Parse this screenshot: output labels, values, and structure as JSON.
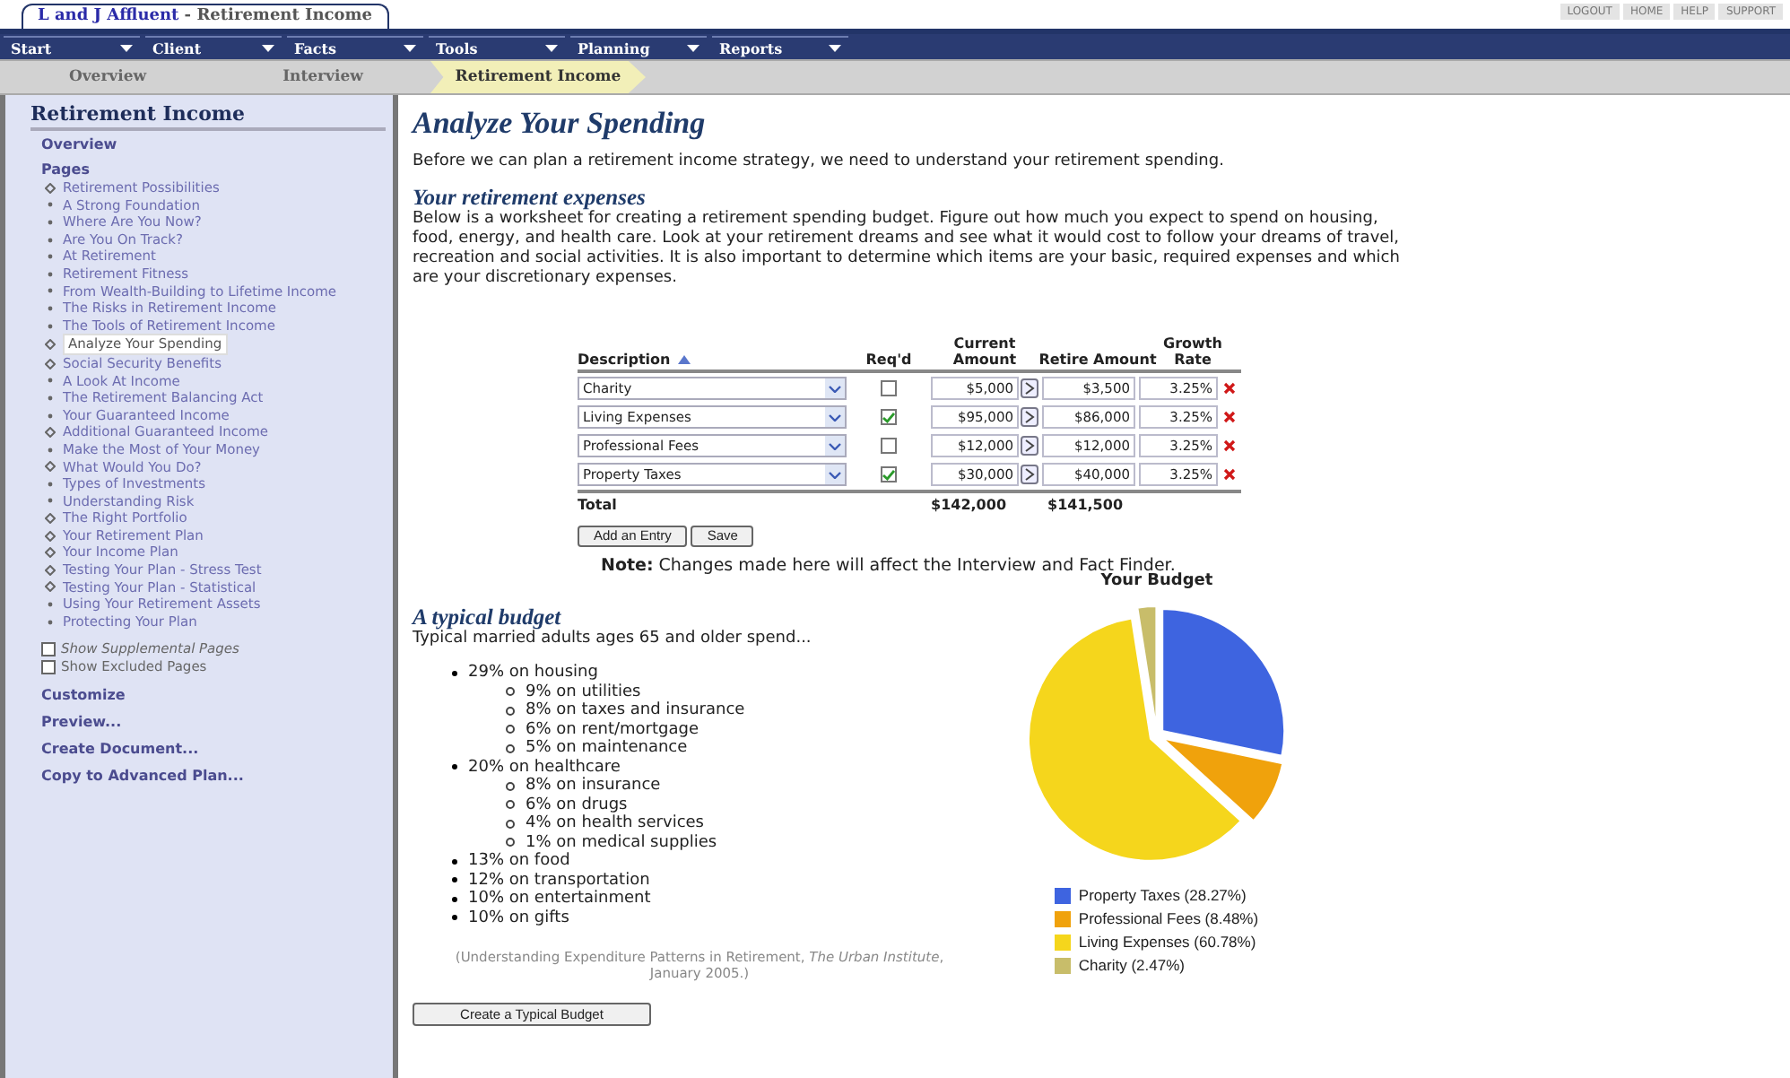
{
  "app_title": {
    "firm": "L and J Affluent",
    "separator": " - ",
    "page": "Retirement Income"
  },
  "top_links": [
    "LOGOUT",
    "HOME",
    "HELP",
    "SUPPORT"
  ],
  "menu": [
    "Start",
    "Client",
    "Facts",
    "Tools",
    "Planning",
    "Reports"
  ],
  "breadcrumb": [
    {
      "label": "Overview",
      "selected": false
    },
    {
      "label": "Interview",
      "selected": false
    },
    {
      "label": "Retirement Income",
      "selected": true
    }
  ],
  "sidebar": {
    "title": "Retirement Income",
    "overview": "Overview",
    "pages_label": "Pages",
    "pages": [
      {
        "label": "Retirement Possibilities",
        "kind": "diamond",
        "selected": false
      },
      {
        "label": "A Strong Foundation",
        "kind": "dot",
        "selected": false
      },
      {
        "label": "Where Are You Now?",
        "kind": "dot",
        "selected": false
      },
      {
        "label": "Are You On Track?",
        "kind": "dot",
        "selected": false
      },
      {
        "label": "At Retirement",
        "kind": "dot",
        "selected": false
      },
      {
        "label": "Retirement Fitness",
        "kind": "dot",
        "selected": false
      },
      {
        "label": "From Wealth-Building to Lifetime Income",
        "kind": "dot",
        "selected": false
      },
      {
        "label": "The Risks in Retirement Income",
        "kind": "dot",
        "selected": false
      },
      {
        "label": "The Tools of Retirement Income",
        "kind": "dot",
        "selected": false
      },
      {
        "label": "Analyze Your Spending",
        "kind": "diamond",
        "selected": true
      },
      {
        "label": "Social Security Benefits",
        "kind": "diamond",
        "selected": false
      },
      {
        "label": "A Look At Income",
        "kind": "dot",
        "selected": false
      },
      {
        "label": "The Retirement Balancing Act",
        "kind": "dot",
        "selected": false
      },
      {
        "label": "Your Guaranteed Income",
        "kind": "dot",
        "selected": false
      },
      {
        "label": "Additional Guaranteed Income",
        "kind": "diamond",
        "selected": false
      },
      {
        "label": "Make the Most of Your Money",
        "kind": "dot",
        "selected": false
      },
      {
        "label": "What Would You Do?",
        "kind": "diamond",
        "selected": false
      },
      {
        "label": "Types of Investments",
        "kind": "dot",
        "selected": false
      },
      {
        "label": "Understanding Risk",
        "kind": "dot",
        "selected": false
      },
      {
        "label": "The Right Portfolio",
        "kind": "diamond",
        "selected": false
      },
      {
        "label": "Your Retirement Plan",
        "kind": "diamond",
        "selected": false
      },
      {
        "label": "Your Income Plan",
        "kind": "diamond",
        "selected": false
      },
      {
        "label": "Testing Your Plan - Stress Test",
        "kind": "diamond",
        "selected": false
      },
      {
        "label": "Testing Your Plan - Statistical",
        "kind": "diamond",
        "selected": false
      },
      {
        "label": "Using Your Retirement Assets",
        "kind": "dot",
        "selected": false
      },
      {
        "label": "Protecting Your Plan",
        "kind": "dot",
        "selected": false
      }
    ],
    "options": [
      {
        "label": "Show Supplemental Pages",
        "checked": false,
        "italic": true
      },
      {
        "label": "Show Excluded Pages",
        "checked": false,
        "italic": false
      }
    ],
    "actions": [
      "Customize",
      "Preview...",
      "Create Document...",
      "Copy to Advanced Plan..."
    ]
  },
  "main": {
    "title": "Analyze Your Spending",
    "intro": "Before we can plan a retirement income strategy, we need to understand your retirement spending.",
    "expenses_heading": "Your retirement expenses",
    "expenses_text": "Below is a worksheet for creating a retirement spending budget. Figure out how much you expect to spend on housing, food, energy, and health care. Look at your retirement dreams and see what it would cost to follow your dreams of travel, recreation and social activities. It is also important to determine which items are your basic, required expenses and which are your discretionary expenses.",
    "table": {
      "columns": [
        "Description",
        "Req'd",
        "Current Amount",
        "Retire Amount",
        "Growth Rate"
      ],
      "rows": [
        {
          "description": "Charity",
          "required": false,
          "current": "$5,000",
          "retire": "$3,500",
          "growth": "3.25%"
        },
        {
          "description": "Living Expenses",
          "required": true,
          "current": "$95,000",
          "retire": "$86,000",
          "growth": "3.25%"
        },
        {
          "description": "Professional Fees",
          "required": false,
          "current": "$12,000",
          "retire": "$12,000",
          "growth": "3.25%"
        },
        {
          "description": "Property Taxes",
          "required": true,
          "current": "$30,000",
          "retire": "$40,000",
          "growth": "3.25%"
        }
      ],
      "total_label": "Total",
      "total_current": "$142,000",
      "total_retire": "$141,500"
    },
    "buttons": [
      "Add an Entry",
      "Save"
    ],
    "note_label": "Note:",
    "note_text": "Changes made here will affect the Interview and Fact Finder.",
    "budget_heading": "A typical budget",
    "budget_intro": "Typical married adults ages 65 and older spend...",
    "budget_items": [
      {
        "label": "29% on housing",
        "children": [
          {
            "label": "9% on utilities"
          },
          {
            "label": "8% on taxes and insurance"
          },
          {
            "label": "6% on rent/mortgage"
          },
          {
            "label": "5% on maintenance"
          }
        ]
      },
      {
        "label": "20% on healthcare",
        "children": [
          {
            "label": "8% on insurance"
          },
          {
            "label": "6% on drugs"
          },
          {
            "label": "4% on health services"
          },
          {
            "label": "1% on medical supplies"
          }
        ]
      },
      {
        "label": "13% on food"
      },
      {
        "label": "12% on transportation"
      },
      {
        "label": "10% on entertainment"
      },
      {
        "label": "10% on gifts"
      }
    ],
    "citation": "(Understanding Expenditure Patterns in Retirement, *The Urban Institute*, January 2005.)",
    "create_button": "Create a Typical Budget",
    "chart_data": {
      "type": "pie",
      "title": "Your Budget",
      "categories": [
        "Property Taxes (28.27%)",
        "Professional Fees (8.48%)",
        "Living Expenses (60.78%)",
        "Charity (2.47%)"
      ],
      "legend": "bottom",
      "series": [
        {
          "colors": [
            "#3e64e0",
            "#f0a20c",
            "#f5d61c",
            "#c8bd6a"
          ],
          "values": [
            28.27,
            8.48,
            60.78,
            2.47
          ]
        }
      ]
    }
  }
}
